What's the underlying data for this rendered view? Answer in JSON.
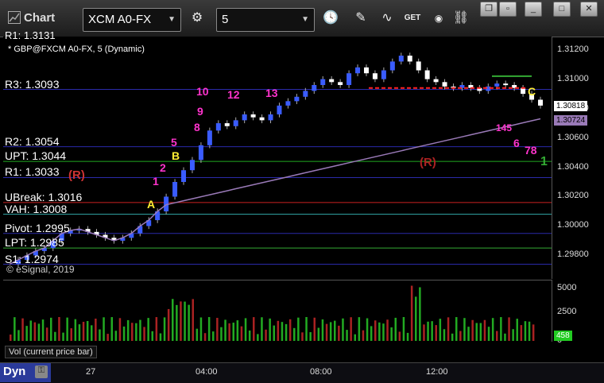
{
  "window": {
    "title": "Chart"
  },
  "toolbar": {
    "symbol": "XCM A0-FX",
    "interval": "5",
    "get_label": "GET"
  },
  "legend": {
    "symbol_line": "* GBP@FXCM A0-FX, 5 (Dynamic)",
    "top_partial": "R1: 1.3131",
    "watermark": "© eSignal, 2019"
  },
  "levels": [
    {
      "label": "R3: 1.3093",
      "price": 1.3093
    },
    {
      "label": "R2: 1.3054",
      "price": 1.3054
    },
    {
      "label": "UPT: 1.3044",
      "price": 1.3044
    },
    {
      "label": "R1: 1.3033",
      "price": 1.3033
    },
    {
      "label": "UBreak: 1.3016",
      "price": 1.3016
    },
    {
      "label": "VAH: 1.3008",
      "price": 1.3008
    },
    {
      "label": "Pivot: 1.2995",
      "price": 1.2995
    },
    {
      "label": "LPT: 1.2985",
      "price": 1.2985
    },
    {
      "label": "S1: 1.2974",
      "price": 1.2974
    }
  ],
  "price_axis": {
    "ticks": [
      "1.31200",
      "1.31000",
      "1.30800",
      "1.30600",
      "1.30400",
      "1.30200",
      "1.30000",
      "1.29800"
    ],
    "last_price": "1.30818",
    "vwap_price": "1.30724"
  },
  "volume_axis": {
    "ticks": [
      "5000",
      "2500",
      "0"
    ],
    "last_volume": "458"
  },
  "volume_label": "Vol (current price bar)",
  "time_axis": {
    "ticks": [
      "27",
      "04:00",
      "08:00",
      "12:00"
    ]
  },
  "markers": {
    "r_label": "(R)",
    "r_label_2": "(R)",
    "a": "A",
    "b": "B",
    "c": "C",
    "a2": "A",
    "n1": "1",
    "n2": "2",
    "n5": "5",
    "n8": "8",
    "n9": "9",
    "n10": "10",
    "n12": "12",
    "n13": "13",
    "n6": "6",
    "n78": "78",
    "n145": "145",
    "n1b": "1"
  },
  "bottom": {
    "workspace": "Dyn"
  },
  "colors": {
    "up": "#3a5cff",
    "down": "#ffffff",
    "magenta": "#ff33cc",
    "yellow": "#ffee33",
    "green": "#33aa33",
    "vwap": "#9a7ab8"
  }
}
